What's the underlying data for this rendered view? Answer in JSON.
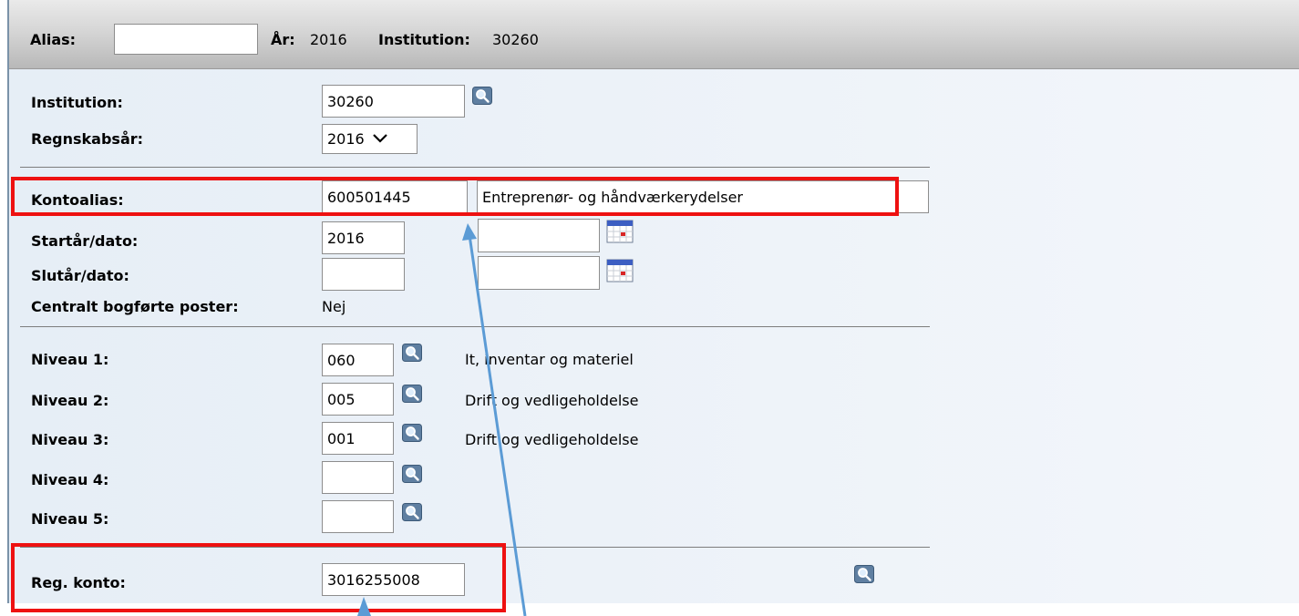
{
  "header": {
    "alias_label": "Alias:",
    "alias_value": "",
    "year_label": "År:",
    "year_value": "2016",
    "institution_label": "Institution:",
    "institution_value": "30260"
  },
  "form": {
    "institution": {
      "label": "Institution:",
      "value": "30260"
    },
    "fiscal_year": {
      "label": "Regnskabsår:",
      "value": "2016"
    },
    "kontoalias": {
      "label": "Kontoalias:",
      "value": "600501445",
      "name": "Entreprenør- og håndværkerydelser"
    },
    "start": {
      "label": "Startår/dato:",
      "year": "2016",
      "date": ""
    },
    "end": {
      "label": "Slutår/dato:",
      "year": "",
      "date": ""
    },
    "central": {
      "label": "Centralt bogførte poster:",
      "value": "Nej"
    },
    "levels": [
      {
        "label": "Niveau 1:",
        "value": "060",
        "desc": "It, inventar og materiel"
      },
      {
        "label": "Niveau 2:",
        "value": "005",
        "desc": "Drift og vedligeholdelse"
      },
      {
        "label": "Niveau 3:",
        "value": "001",
        "desc": "Drift og vedligeholdelse"
      },
      {
        "label": "Niveau 4:",
        "value": "",
        "desc": ""
      },
      {
        "label": "Niveau 5:",
        "value": "",
        "desc": ""
      }
    ],
    "reg_konto": {
      "label": "Reg. konto:",
      "value": "3016255008"
    }
  },
  "annotations": {
    "highlight_color": "#ee1111",
    "arrow_color": "#5b9bd5"
  },
  "icons": {
    "lookup": "magnifier-icon",
    "date": "calendar-icon"
  }
}
